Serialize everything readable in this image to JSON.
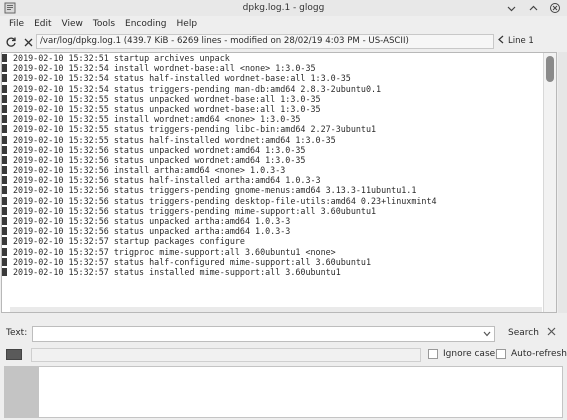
{
  "window": {
    "title": "dpkg.log.1 - glogg"
  },
  "menu": [
    "File",
    "Edit",
    "View",
    "Tools",
    "Encoding",
    "Help"
  ],
  "toolbar": {
    "file_info": "/var/log/dpkg.log.1 (439.7 KiB - 6269 lines - modified on 28/02/19 4:03 PM - US-ASCII)",
    "line_indicator": "Line 1"
  },
  "log_lines": [
    "2019-02-10 15:32:51 startup archives unpack",
    "2019-02-10 15:32:54 install wordnet-base:all <none> 1:3.0-35",
    "2019-02-10 15:32:54 status half-installed wordnet-base:all 1:3.0-35",
    "2019-02-10 15:32:54 status triggers-pending man-db:amd64 2.8.3-2ubuntu0.1",
    "2019-02-10 15:32:55 status unpacked wordnet-base:all 1:3.0-35",
    "2019-02-10 15:32:55 status unpacked wordnet-base:all 1:3.0-35",
    "2019-02-10 15:32:55 install wordnet:amd64 <none> 1:3.0-35",
    "2019-02-10 15:32:55 status triggers-pending libc-bin:amd64 2.27-3ubuntu1",
    "2019-02-10 15:32:55 status half-installed wordnet:amd64 1:3.0-35",
    "2019-02-10 15:32:56 status unpacked wordnet:amd64 1:3.0-35",
    "2019-02-10 15:32:56 status unpacked wordnet:amd64 1:3.0-35",
    "2019-02-10 15:32:56 install artha:amd64 <none> 1.0.3-3",
    "2019-02-10 15:32:56 status half-installed artha:amd64 1.0.3-3",
    "2019-02-10 15:32:56 status triggers-pending gnome-menus:amd64 3.13.3-11ubuntu1.1",
    "2019-02-10 15:32:56 status triggers-pending desktop-file-utils:amd64 0.23+linuxmint4",
    "2019-02-10 15:32:56 status triggers-pending mime-support:all 3.60ubuntu1",
    "2019-02-10 15:32:56 status unpacked artha:amd64 1.0.3-3",
    "2019-02-10 15:32:56 status unpacked artha:amd64 1.0.3-3",
    "2019-02-10 15:32:57 startup packages configure",
    "2019-02-10 15:32:57 trigproc mime-support:all 3.60ubuntu1 <none>",
    "2019-02-10 15:32:57 status half-configured mime-support:all 3.60ubuntu1",
    "2019-02-10 15:32:57 status installed mime-support:all 3.60ubuntu1"
  ],
  "search": {
    "label": "Text:",
    "button": "Search",
    "ignore_case": "Ignore case",
    "auto_refresh": "Auto-refresh"
  }
}
